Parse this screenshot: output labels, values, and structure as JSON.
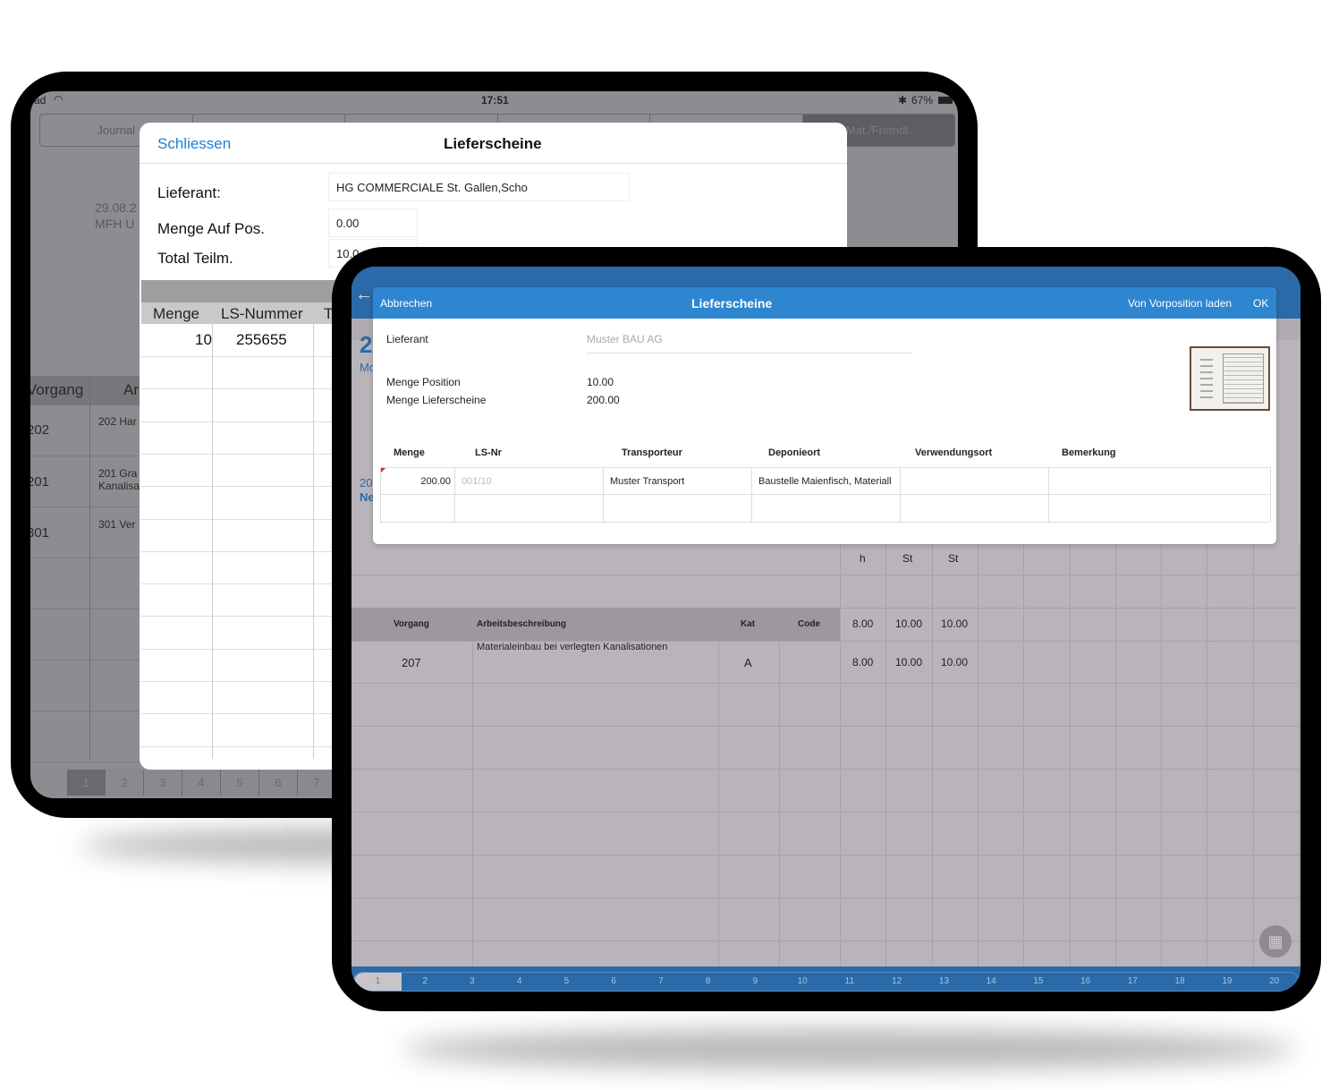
{
  "back_tablet": {
    "status": {
      "left": "ad",
      "time": "17:51",
      "battery": "67%"
    },
    "tabs": [
      "Journal",
      "",
      "",
      "",
      "",
      "Mat./Fremdl."
    ],
    "selected_tab": 5,
    "date": "29.08.2",
    "project": "MFH U",
    "table": {
      "headers": [
        "Vorgang",
        "Ar"
      ],
      "rows": [
        [
          "202",
          "202 Har",
          ""
        ],
        [
          "201",
          "201 Gra",
          "Kanalisa"
        ],
        [
          "301",
          "301 Ver",
          ""
        ]
      ]
    },
    "pages": [
      "1",
      "2",
      "3",
      "4",
      "5",
      "6",
      "7"
    ],
    "selected_page": 0,
    "modal": {
      "close": "Schliessen",
      "title": "Lieferscheine",
      "fields": [
        {
          "label": "Lieferant:",
          "value": "HG COMMERCIALE St. Gallen,Scho"
        },
        {
          "label": "Menge Auf Pos.",
          "value": "0.00"
        },
        {
          "label": "Total Teilm.",
          "value": "10.0"
        }
      ],
      "columns": [
        "Menge",
        "LS-Nummer",
        "T"
      ],
      "rows": [
        [
          "10",
          "255655"
        ]
      ]
    }
  },
  "front_tablet": {
    "fragments": {
      "big": "2",
      "sub": "Mc",
      "row_num": "20",
      "row_name": "Ne"
    },
    "modal": {
      "cancel": "Abbrechen",
      "title": "Lieferscheine",
      "load": "Von Vorposition laden",
      "ok": "OK",
      "lieferant_label": "Lieferant",
      "lieferant_value": "Muster BAU AG",
      "menge_position_label": "Menge Position",
      "menge_position": "10.00",
      "menge_lieferscheine_label": "Menge Lieferscheine",
      "menge_lieferscheine": "200.00",
      "columns": [
        "Menge",
        "LS-Nr",
        "Transporteur",
        "Deponieort",
        "Verwendungsort",
        "Bemerkung"
      ],
      "rows": [
        [
          "200.00",
          "001/10",
          "Muster Transport",
          "Baustelle Maienfisch, Materiall",
          "",
          ""
        ],
        [
          "",
          "",
          "",
          "",
          "",
          ""
        ]
      ]
    },
    "units": [
      "h",
      "St",
      "St"
    ],
    "table_headers": {
      "vorgang": "Vorgang",
      "beschreibung": "Arbeitsbeschreibung",
      "kat": "Kat",
      "code": "Code"
    },
    "totals": [
      "8.00",
      "10.00",
      "10.00"
    ],
    "rows": [
      {
        "vorgang": "207",
        "beschreibung": "Materialeinbau bei verlegten Kanalisationen",
        "kat": "A",
        "code": "",
        "values": [
          "8.00",
          "10.00",
          "10.00"
        ]
      }
    ],
    "pages": [
      "1",
      "2",
      "3",
      "4",
      "5",
      "6",
      "7",
      "8",
      "9",
      "10",
      "11",
      "12",
      "13",
      "14",
      "15",
      "16",
      "17",
      "18",
      "19",
      "20"
    ],
    "selected_page": 0,
    "colors": {
      "header_blue": "#2e86d0",
      "bar_blue": "#2a6aa8",
      "background": "#b9b4ba"
    }
  }
}
